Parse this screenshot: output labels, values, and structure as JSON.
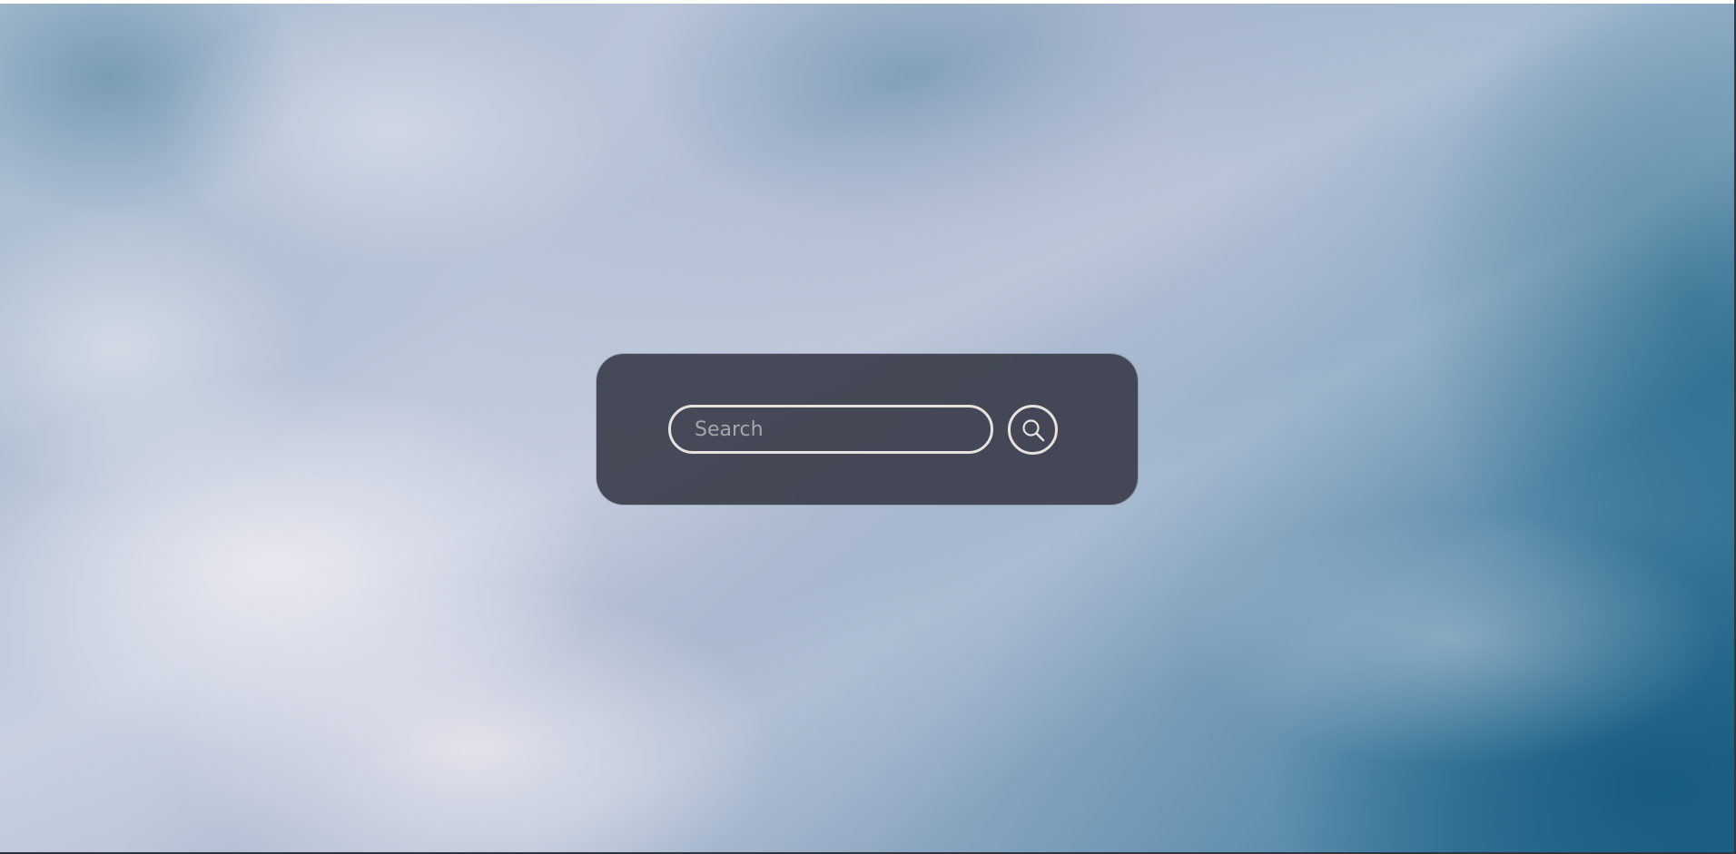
{
  "search": {
    "placeholder": "Search",
    "value": "",
    "button_icon": "search-icon"
  },
  "colors": {
    "panel_bg": "#3c404c",
    "outline": "#e8e2de",
    "placeholder_text": "#a6a7ac"
  }
}
